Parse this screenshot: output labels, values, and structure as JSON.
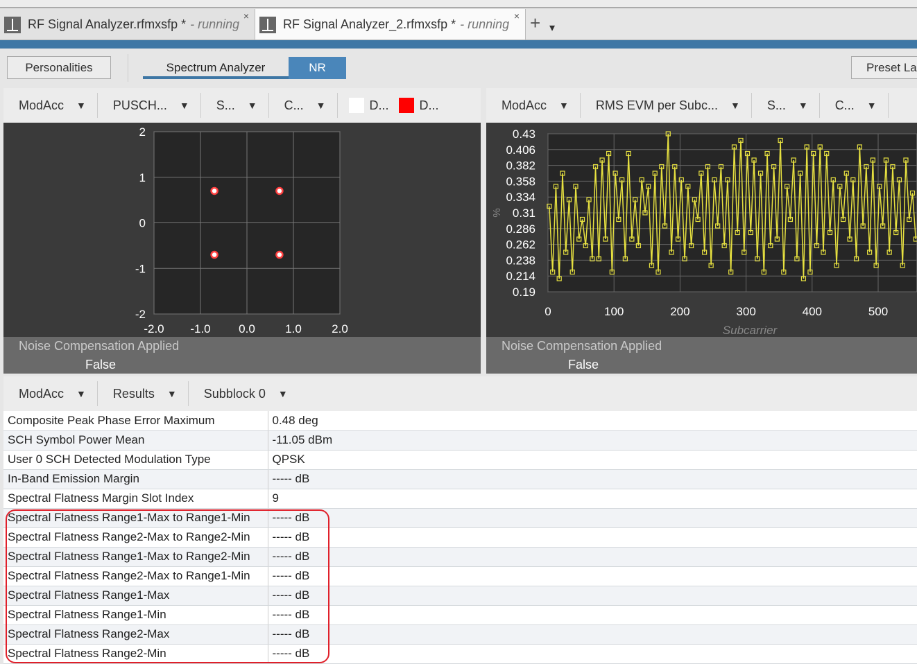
{
  "tabs": [
    {
      "title": "RF Signal Analyzer.rfmxsfp *",
      "status": "- running",
      "close": "×"
    },
    {
      "title": "RF Signal Analyzer_2.rfmxsfp *",
      "status": "- running",
      "close": "×"
    }
  ],
  "tab_add": "+",
  "tab_menu": "▾",
  "toolbar": {
    "personalities": "Personalities",
    "spectrum_analyzer": "Spectrum Analyzer",
    "nr": "NR",
    "preset": "Preset La"
  },
  "colors": {
    "accent": "#3e77a5",
    "trace": "#e6e040",
    "constellation": "#ff4040",
    "legend_1": "#ffffff",
    "legend_2": "#ff0000"
  },
  "left_panel": {
    "dropdowns": [
      "ModAcc",
      "PUSCH...",
      "S...",
      "C..."
    ],
    "legend": [
      "D...",
      "D..."
    ],
    "footer_label": "Noise Compensation Applied",
    "footer_value": "False"
  },
  "right_panel": {
    "dropdowns": [
      "ModAcc",
      "RMS EVM per Subc...",
      "S...",
      "C..."
    ],
    "footer_label": "Noise Compensation Applied",
    "footer_value": "False"
  },
  "chart_data": [
    {
      "type": "scatter",
      "xlim": [
        -2,
        2
      ],
      "ylim": [
        -2,
        2
      ],
      "xticks": [
        "-2.0",
        "-1.0",
        "0.0",
        "1.0",
        "2.0"
      ],
      "yticks": [
        "2",
        "1",
        "0",
        "-1",
        "-2"
      ],
      "points": [
        [
          -0.7,
          0.7
        ],
        [
          0.7,
          0.7
        ],
        [
          -0.7,
          -0.7
        ],
        [
          0.7,
          -0.7
        ]
      ],
      "grid": true
    },
    {
      "type": "line",
      "xlabel": "Subcarrier",
      "ylabel": "%",
      "xlim": [
        0,
        555
      ],
      "ylim": [
        0.19,
        0.43
      ],
      "xticks": [
        "0",
        "100",
        "200",
        "300",
        "400",
        "500"
      ],
      "yticks": [
        "0.43",
        "0.406",
        "0.382",
        "0.358",
        "0.334",
        "0.31",
        "0.286",
        "0.262",
        "0.238",
        "0.214",
        "0.19"
      ],
      "x_step": 5,
      "values": [
        0.32,
        0.22,
        0.35,
        0.21,
        0.37,
        0.25,
        0.33,
        0.22,
        0.35,
        0.27,
        0.3,
        0.26,
        0.33,
        0.24,
        0.38,
        0.24,
        0.39,
        0.27,
        0.4,
        0.22,
        0.37,
        0.3,
        0.36,
        0.24,
        0.4,
        0.27,
        0.33,
        0.26,
        0.36,
        0.31,
        0.35,
        0.23,
        0.37,
        0.22,
        0.38,
        0.29,
        0.43,
        0.25,
        0.38,
        0.27,
        0.36,
        0.24,
        0.35,
        0.26,
        0.33,
        0.3,
        0.37,
        0.25,
        0.38,
        0.23,
        0.36,
        0.29,
        0.38,
        0.26,
        0.36,
        0.22,
        0.41,
        0.28,
        0.42,
        0.25,
        0.4,
        0.28,
        0.39,
        0.24,
        0.37,
        0.22,
        0.4,
        0.26,
        0.38,
        0.27,
        0.42,
        0.22,
        0.35,
        0.3,
        0.39,
        0.24,
        0.37,
        0.21,
        0.41,
        0.22,
        0.4,
        0.26,
        0.41,
        0.25,
        0.4,
        0.28,
        0.36,
        0.23,
        0.35,
        0.3,
        0.37,
        0.27,
        0.36,
        0.24,
        0.41,
        0.29,
        0.38,
        0.25,
        0.39,
        0.23,
        0.35,
        0.29,
        0.39,
        0.25,
        0.38,
        0.28,
        0.36,
        0.23,
        0.39,
        0.3,
        0.34,
        0.27
      ]
    }
  ],
  "results": {
    "dropdowns": [
      "ModAcc",
      "Results",
      "Subblock 0"
    ],
    "rows": [
      [
        "Composite Peak Phase Error Maximum",
        "0.48 deg"
      ],
      [
        "SCH Symbol Power Mean",
        "-11.05 dBm"
      ],
      [
        "User 0 SCH Detected Modulation Type",
        "QPSK"
      ],
      [
        "In-Band Emission Margin",
        "----- dB"
      ],
      [
        "Spectral Flatness Margin Slot Index",
        "9"
      ],
      [
        "Spectral Flatness Range1-Max to Range1-Min",
        "----- dB"
      ],
      [
        "Spectral Flatness Range2-Max to Range2-Min",
        "----- dB"
      ],
      [
        "Spectral Flatness Range1-Max to Range2-Min",
        "----- dB"
      ],
      [
        "Spectral Flatness Range2-Max to Range1-Min",
        "----- dB"
      ],
      [
        "Spectral Flatness Range1-Max",
        "----- dB"
      ],
      [
        "Spectral Flatness Range1-Min",
        "----- dB"
      ],
      [
        "Spectral Flatness Range2-Max",
        "----- dB"
      ],
      [
        "Spectral Flatness Range2-Min",
        "----- dB"
      ]
    ]
  }
}
